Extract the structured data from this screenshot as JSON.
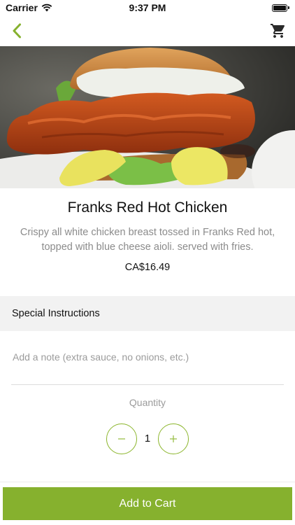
{
  "status_bar": {
    "carrier": "Carrier",
    "time": "9:37 PM"
  },
  "nav": {
    "back_icon": "chevron-left-icon",
    "cart_icon": "shopping-cart-icon",
    "accent_color": "#86b12e"
  },
  "item": {
    "name": "Franks Red Hot Chicken",
    "description": "Crispy all white chicken breast tossed in Franks Red hot, topped with blue cheese aioli. served with fries.",
    "price": "CA$16.49"
  },
  "special_instructions": {
    "header": "Special Instructions",
    "placeholder": "Add a note (extra sauce, no onions, etc.)",
    "value": ""
  },
  "quantity": {
    "label": "Quantity",
    "value": "1",
    "minus_icon": "minus-icon",
    "plus_icon": "plus-icon"
  },
  "add_to_cart": {
    "label": "Add to Cart",
    "color": "#86b12e"
  }
}
